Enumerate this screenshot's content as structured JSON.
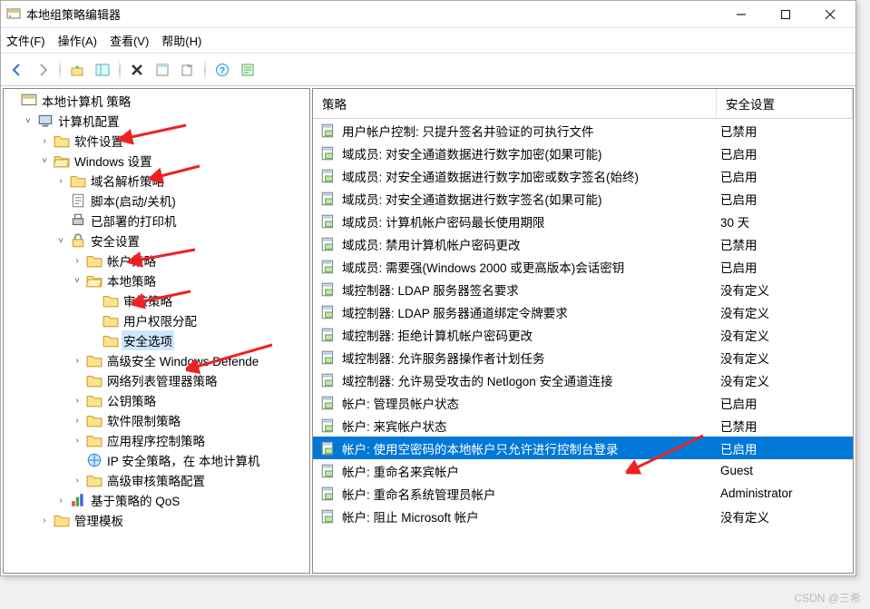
{
  "window": {
    "title": "本地组策略编辑器"
  },
  "menu": {
    "file": "文件(F)",
    "action": "操作(A)",
    "view": "查看(V)",
    "help": "帮助(H)"
  },
  "tree_root": "本地计算机 策略",
  "tree": {
    "computer_config": "计算机配置",
    "software_settings": "软件设置",
    "windows_settings": "Windows 设置",
    "dns_policy": "域名解析策略",
    "scripts": "脚本(启动/关机)",
    "printers": "已部署的打印机",
    "security_settings": "安全设置",
    "account_policies": "帐户策略",
    "local_policies": "本地策略",
    "audit_policy": "审核策略",
    "user_rights": "用户权限分配",
    "security_options": "安全选项",
    "win_defender": "高级安全 Windows Defende",
    "network_list": "网络列表管理器策略",
    "pki_policies": "公钥策略",
    "software_restriction": "软件限制策略",
    "app_control": "应用程序控制策略",
    "ipsec": "IP 安全策略，在 本地计算机",
    "adv_audit": "高级审核策略配置",
    "qos": "基于策略的 QoS",
    "admin_templates": "管理模板"
  },
  "columns": {
    "policy": "策略",
    "security_setting": "安全设置"
  },
  "rows": [
    {
      "name": "用户帐户控制: 只提升签名并验证的可执行文件",
      "value": "已禁用"
    },
    {
      "name": "域成员: 对安全通道数据进行数字加密(如果可能)",
      "value": "已启用"
    },
    {
      "name": "域成员: 对安全通道数据进行数字加密或数字签名(始终)",
      "value": "已启用"
    },
    {
      "name": "域成员: 对安全通道数据进行数字签名(如果可能)",
      "value": "已启用"
    },
    {
      "name": "域成员: 计算机帐户密码最长使用期限",
      "value": "30 天"
    },
    {
      "name": "域成员: 禁用计算机帐户密码更改",
      "value": "已禁用"
    },
    {
      "name": "域成员: 需要强(Windows 2000 或更高版本)会话密钥",
      "value": "已启用"
    },
    {
      "name": "域控制器: LDAP 服务器签名要求",
      "value": "没有定义"
    },
    {
      "name": "域控制器: LDAP 服务器通道绑定令牌要求",
      "value": "没有定义"
    },
    {
      "name": "域控制器: 拒绝计算机帐户密码更改",
      "value": "没有定义"
    },
    {
      "name": "域控制器: 允许服务器操作者计划任务",
      "value": "没有定义"
    },
    {
      "name": "域控制器: 允许易受攻击的 Netlogon 安全通道连接",
      "value": "没有定义"
    },
    {
      "name": "帐户: 管理员帐户状态",
      "value": "已启用"
    },
    {
      "name": "帐户: 来宾帐户状态",
      "value": "已禁用"
    },
    {
      "name": "帐户: 使用空密码的本地帐户只允许进行控制台登录",
      "value": "已启用",
      "selected": true
    },
    {
      "name": "帐户: 重命名来宾帐户",
      "value": "Guest"
    },
    {
      "name": "帐户: 重命名系统管理员帐户",
      "value": "Administrator"
    },
    {
      "name": "帐户: 阻止 Microsoft 帐户",
      "value": "没有定义"
    }
  ],
  "watermark": "CSDN @三希"
}
